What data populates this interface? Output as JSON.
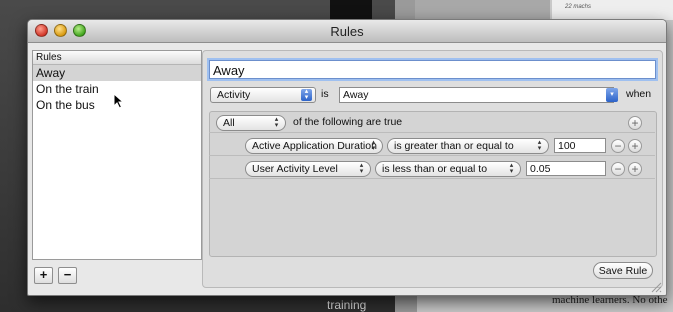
{
  "background": {
    "training_text": "training",
    "right_text": "machine learners. No othe",
    "macros_text": "22 machs"
  },
  "window": {
    "title": "Rules"
  },
  "rules_list": {
    "header": "Rules",
    "items": [
      {
        "label": "Away",
        "selected": true
      },
      {
        "label": "On the train",
        "selected": false
      },
      {
        "label": "On the bus",
        "selected": false
      }
    ]
  },
  "list_buttons": {
    "add": "+",
    "remove": "−"
  },
  "editor": {
    "name_value": "Away",
    "trigger_type": "Activity",
    "is_label": "is",
    "trigger_value": "Away",
    "when_label": "when",
    "match_mode": "All",
    "match_suffix": "of the following are true",
    "conditions": [
      {
        "field": "Active Application Duration",
        "operator": "is greater than or equal to",
        "value": "100"
      },
      {
        "field": "User Activity Level",
        "operator": "is less than or equal to",
        "value": "0.05"
      }
    ],
    "save_label": "Save Rule"
  },
  "icons": {
    "add": "+",
    "remove": "−",
    "stepper": "▴▾",
    "dropdown": "▾"
  }
}
